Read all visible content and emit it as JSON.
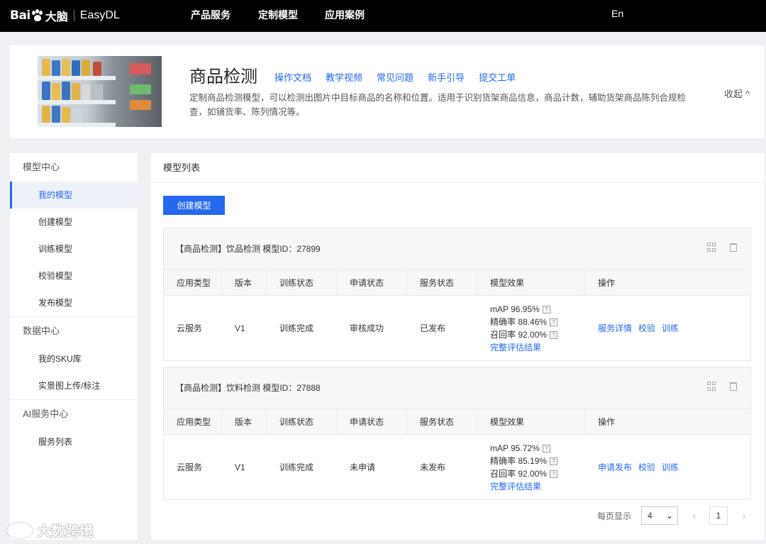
{
  "nav": {
    "logo_text": "Bai",
    "logo_cn": "大脑",
    "product": "EasyDL",
    "items": [
      "产品服务",
      "定制模型",
      "应用案例"
    ],
    "lang": "En"
  },
  "hero": {
    "title": "商品检测",
    "links": [
      "操作文档",
      "教学视频",
      "常见问题",
      "新手引导",
      "提交工单"
    ],
    "description": "定制商品检测模型，可以检测出图片中目标商品的名称和位置。适用于识别货架商品信息，商品计数，辅助货架商品陈列合规检查，如铺货率、陈列情况等。",
    "collapse_label": "收起"
  },
  "sidebar": {
    "groups": [
      {
        "label": "模型中心",
        "items": [
          "我的模型",
          "创建模型",
          "训练模型",
          "校验模型",
          "发布模型"
        ]
      },
      {
        "label": "数据中心",
        "items": [
          "我的SKU库",
          "实景图上传/标注"
        ]
      },
      {
        "label": "AI服务中心",
        "items": [
          "服务列表"
        ]
      }
    ],
    "active": "我的模型"
  },
  "main": {
    "title": "模型列表",
    "create_button": "创建模型",
    "columns": [
      "应用类型",
      "版本",
      "训练状态",
      "申请状态",
      "服务状态",
      "模型效果",
      "操作"
    ],
    "models": [
      {
        "header": "【商品检测】饮品检测  模型ID：27899",
        "app_type": "云服务",
        "version": "V1",
        "train_status": "训练完成",
        "apply_status": "审核成功",
        "service_status": "已发布",
        "metrics": [
          "mAP 96.95%",
          "精确率 88.46%",
          "召回率 92.00%"
        ],
        "full_eval": "完整评估结果",
        "ops": [
          "服务详情",
          "校验",
          "训练"
        ]
      },
      {
        "header": "【商品检测】饮料检测  模型ID：27888",
        "app_type": "云服务",
        "version": "V1",
        "train_status": "训练完成",
        "apply_status": "未申请",
        "service_status": "未发布",
        "metrics": [
          "mAP 95.72%",
          "精确率 85.19%",
          "召回率 92.00%"
        ],
        "full_eval": "完整评估结果",
        "ops": [
          "申请发布",
          "校验",
          "训练"
        ]
      }
    ]
  },
  "pager": {
    "per_page_label": "每页显示",
    "per_page": "4",
    "current_page": "1"
  },
  "watermark": "大数跨境",
  "accent_color": "#2468f2"
}
